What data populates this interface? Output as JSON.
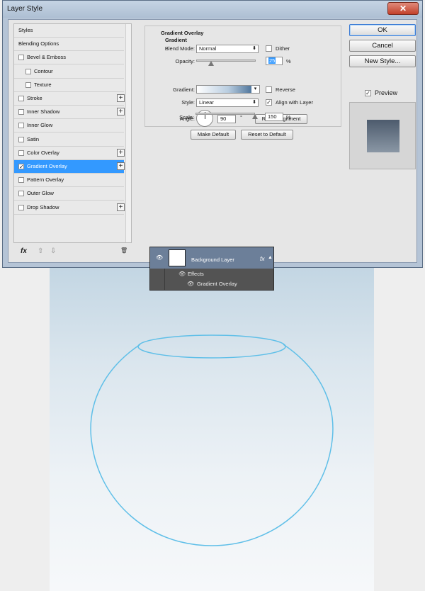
{
  "window": {
    "title": "Layer Style",
    "close_glyph": "✕"
  },
  "styles_list": {
    "items": [
      {
        "label": "Styles",
        "checkbox": false,
        "checked": false,
        "plus": false,
        "indent": 0,
        "selected": false
      },
      {
        "label": "Blending Options",
        "checkbox": false,
        "checked": false,
        "plus": false,
        "indent": 0,
        "selected": false
      },
      {
        "label": "Bevel & Emboss",
        "checkbox": true,
        "checked": false,
        "plus": false,
        "indent": 0,
        "selected": false
      },
      {
        "label": "Contour",
        "checkbox": true,
        "checked": false,
        "plus": false,
        "indent": 1,
        "selected": false
      },
      {
        "label": "Texture",
        "checkbox": true,
        "checked": false,
        "plus": false,
        "indent": 1,
        "selected": false
      },
      {
        "label": "Stroke",
        "checkbox": true,
        "checked": false,
        "plus": true,
        "indent": 0,
        "selected": false
      },
      {
        "label": "Inner Shadow",
        "checkbox": true,
        "checked": false,
        "plus": true,
        "indent": 0,
        "selected": false
      },
      {
        "label": "Inner Glow",
        "checkbox": true,
        "checked": false,
        "plus": false,
        "indent": 0,
        "selected": false
      },
      {
        "label": "Satin",
        "checkbox": true,
        "checked": false,
        "plus": false,
        "indent": 0,
        "selected": false
      },
      {
        "label": "Color Overlay",
        "checkbox": true,
        "checked": false,
        "plus": true,
        "indent": 0,
        "selected": false
      },
      {
        "label": "Gradient Overlay",
        "checkbox": true,
        "checked": true,
        "plus": true,
        "indent": 0,
        "selected": true
      },
      {
        "label": "Pattern Overlay",
        "checkbox": true,
        "checked": false,
        "plus": false,
        "indent": 0,
        "selected": false
      },
      {
        "label": "Outer Glow",
        "checkbox": true,
        "checked": false,
        "plus": false,
        "indent": 0,
        "selected": false
      },
      {
        "label": "Drop Shadow",
        "checkbox": true,
        "checked": false,
        "plus": true,
        "indent": 0,
        "selected": false
      }
    ],
    "footer": {
      "fx": "fx",
      "up": "⇧",
      "down": "⇩",
      "trash": "🗑"
    }
  },
  "gradient_overlay": {
    "group_title": "Gradient Overlay",
    "group_subtitle": "Gradient",
    "blend_mode_label": "Blend Mode:",
    "blend_mode_value": "Normal",
    "dither_label": "Dither",
    "dither_checked": false,
    "opacity_label": "Opacity:",
    "opacity_value": "25",
    "opacity_fraction": 0.25,
    "percent": "%",
    "gradient_label": "Gradient:",
    "reverse_label": "Reverse",
    "reverse_checked": false,
    "style_label": "Style:",
    "style_value": "Linear",
    "align_label": "Align with Layer",
    "align_checked": true,
    "angle_label": "Angle:",
    "angle_value": "90",
    "degree": "°",
    "reset_alignment": "Reset Alignment",
    "scale_label": "Scale:",
    "scale_value": "150",
    "scale_fraction": 1.0,
    "make_default": "Make Default",
    "reset_default": "Reset to Default",
    "gradient_colors": [
      "#ffffff",
      "#b9cde0",
      "#2d5a86"
    ]
  },
  "buttons": {
    "ok": "OK",
    "cancel": "Cancel",
    "new_style": "New Style...",
    "preview_label": "Preview",
    "preview_checked": true
  },
  "layers_panel": {
    "layer_name": "Background Layer",
    "fx": "fx",
    "effects": "Effects",
    "effect_item": "Gradient Overlay",
    "eye_icon": "visibility-eye",
    "selected_color": "#6c7f99"
  },
  "canvas": {
    "bowl_stroke": "#5fbfe8",
    "bg_top": "#c3d6e3",
    "bg_bottom": "#f6f8fa"
  }
}
